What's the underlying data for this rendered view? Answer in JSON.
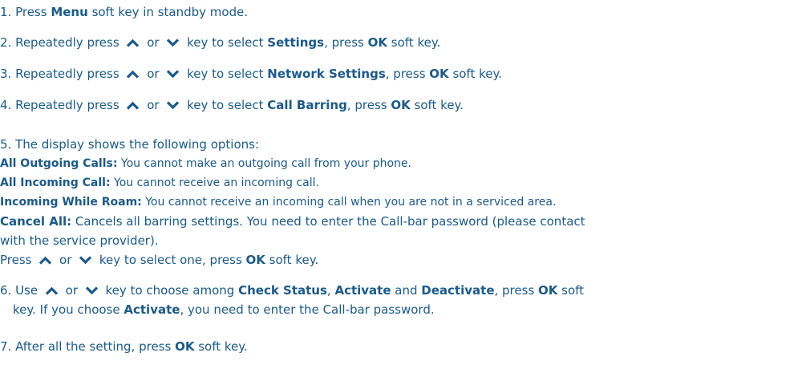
{
  "icons": {
    "up": "chevron-up-icon",
    "down": "chevron-down-icon"
  },
  "step1": {
    "prefix": "1. Press ",
    "menu": "Menu",
    "suffix": " soft key in standby mode."
  },
  "step2": {
    "prefix": "2. Repeatedly press ",
    "or": " or ",
    "mid": " key to select ",
    "target": "Settings",
    "press": ", press ",
    "ok": "OK",
    "suffix": " soft key."
  },
  "step3": {
    "prefix": "3. Repeatedly press ",
    "or": " or ",
    "mid": " key to select ",
    "target": "Network Settings",
    "press": ", press ",
    "ok": "OK",
    "suffix": " soft key."
  },
  "step4": {
    "prefix": "4. Repeatedly press ",
    "or": " or ",
    "mid": " key to select ",
    "target": "Call Barring",
    "press": ", press ",
    "ok": "OK",
    "suffix": " soft key."
  },
  "step5": {
    "intro": "5. The display shows the following options:",
    "options": [
      {
        "label": "All Outgoing Calls:",
        "text": " You cannot make an outgoing call from your phone."
      },
      {
        "label": "All Incoming Call:",
        "text": " You cannot receive an incoming call."
      },
      {
        "label": "Incoming While Roam:",
        "text": " You cannot receive an incoming call when you are not in a serviced area."
      },
      {
        "label": "Cancel All:",
        "text": " Cancels all barring settings. You need to enter the Call-bar password  (please contact"
      }
    ],
    "cancel_cont": "with the service provider).",
    "press_prefix": "Press ",
    "press_or": " or ",
    "press_mid": " key to select one, press ",
    "press_ok": "OK",
    "press_suffix": " soft key."
  },
  "step6": {
    "prefix": "6. Use ",
    "or": " or ",
    "mid": " key to choose among ",
    "opt1": "Check Status",
    "sep1": ", ",
    "opt2": "Activate",
    "and": " and ",
    "opt3": "Deactivate",
    "press": ", press ",
    "ok": "OK",
    "soft": " soft",
    "line2_a": "key. If you choose ",
    "line2_activate": "Activate",
    "line2_b": ", you need to enter the Call-bar password."
  },
  "step7": {
    "prefix": "7. After all the setting, press ",
    "ok": "OK",
    "suffix": " soft key."
  }
}
